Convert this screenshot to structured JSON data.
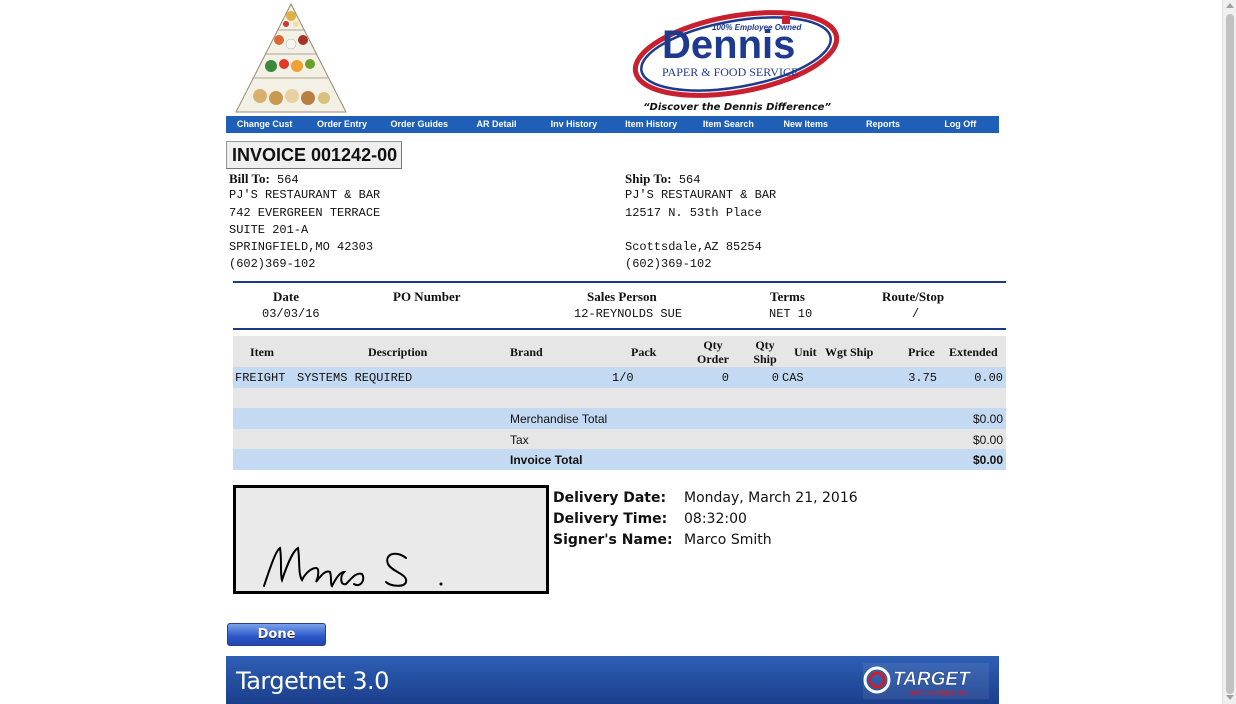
{
  "header": {
    "pyramid_name": "food-pyramid",
    "logo_text": "Dennis",
    "logo_sub": "PAPER & FOOD SERVICE",
    "logo_badge": "100% Employee Owned",
    "tagline": "“Discover the Dennis Difference”"
  },
  "nav": [
    "Change Cust",
    "Order Entry",
    "Order Guides",
    "AR Detail",
    "Inv History",
    "Item History",
    "Item Search",
    "New Items",
    "Reports",
    "Log Off"
  ],
  "invoice": {
    "title": "INVOICE 001242-00",
    "bill_to": {
      "label": "Bill To:",
      "number": "564",
      "lines": [
        "PJ'S RESTAURANT & BAR",
        "742 EVERGREEN TERRACE",
        "SUITE 201-A",
        "SPRINGFIELD,MO 42303",
        "(602)369-102"
      ]
    },
    "ship_to": {
      "label": "Ship To:",
      "number": "564",
      "lines": [
        "PJ'S RESTAURANT & BAR",
        "12517 N. 53th Place",
        "",
        "Scottsdale,AZ 85254",
        "(602)369-102"
      ]
    },
    "info": {
      "date_label": "Date",
      "date": "03/03/16",
      "po_label": "PO Number",
      "po": "",
      "sales_label": "Sales Person",
      "sales": "12-REYNOLDS SUE",
      "terms_label": "Terms",
      "terms": "NET 10",
      "route_label": "Route/Stop",
      "route": "/"
    },
    "columns": {
      "item": "Item",
      "description": "Description",
      "brand": "Brand",
      "pack": "Pack",
      "qty_order_1": "Qty",
      "qty_order_2": "Order",
      "qty_ship_1": "Qty",
      "qty_ship_2": "Ship",
      "unit": "Unit",
      "wgt_ship": "Wgt Ship",
      "price": "Price",
      "extended": "Extended"
    },
    "lines": [
      {
        "item": "FREIGHT",
        "description": "SYSTEMS REQUIRED",
        "brand": "",
        "pack": "1/0",
        "qty_order": "0",
        "qty_ship": "0",
        "unit": "CAS",
        "wgt_ship": "",
        "price": "3.75",
        "extended": "0.00"
      }
    ],
    "totals": {
      "merch_label": "Merchandise Total",
      "merch": "$0.00",
      "tax_label": "Tax",
      "tax": "$0.00",
      "total_label": "Invoice Total",
      "total": "$0.00"
    }
  },
  "delivery": {
    "signature_text": "Marco S.",
    "date_label": "Delivery Date:",
    "date": "Monday, March 21, 2016",
    "time_label": "Delivery Time:",
    "time": "08:32:00",
    "signer_label": "Signer's Name:",
    "signer": "Marco Smith"
  },
  "done_label": "Done",
  "footer": {
    "brand": "Targetnet 3.0",
    "target_text": "TARGET",
    "target_sub": "DATA SYSTEMS, INC."
  },
  "colors": {
    "nav": "#1f5fb8",
    "row_blue": "#c4daf2",
    "row_gray": "#e6e6e6",
    "logo_red": "#c8202e",
    "logo_blue": "#1d3a8f"
  }
}
